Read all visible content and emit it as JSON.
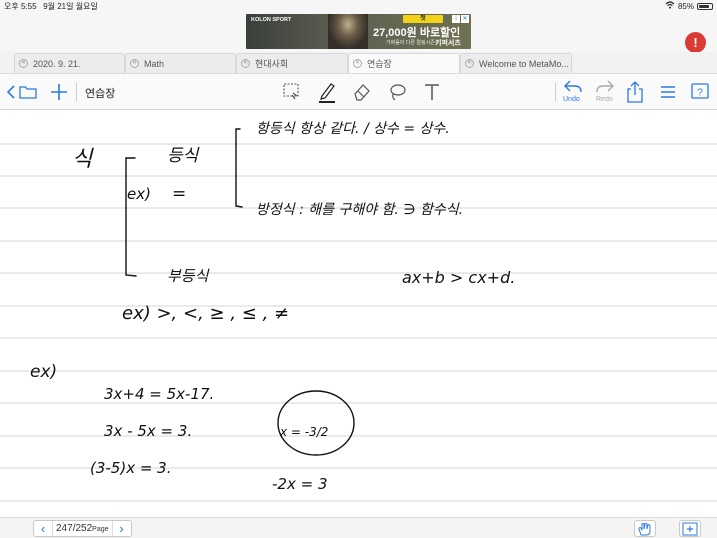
{
  "status_bar": {
    "time": "오후 5:55",
    "date": "9월 21일 월요일",
    "battery": "85%",
    "battery_level": 0.85
  },
  "ad": {
    "brand": "KOLON SPORT",
    "badge": "첫",
    "headline": "27,000원 바로할인",
    "sub": "가벼움이 다른 컬링시즌",
    "brand2": "키퍼서츠"
  },
  "record_button": {
    "glyph": "!"
  },
  "tabs": [
    {
      "label": "2020. 9. 21."
    },
    {
      "label": "Math"
    },
    {
      "label": "현대사회"
    },
    {
      "label": "연습장",
      "active": true
    },
    {
      "label": "Welcome to MetaMo..."
    }
  ],
  "toolbar": {
    "title": "연습장",
    "undo_label": "Undo",
    "redo_label": "Redo",
    "accent": "#2a7ae2"
  },
  "bottom_bar": {
    "page_current": "247",
    "page_total": "252",
    "page_suffix": "Page"
  },
  "handwriting": {
    "line1": "식",
    "equation": "등식",
    "equals_sign": "=",
    "ex1": "ex)",
    "identity": "항등식  항상 같다. / 상수 = 상수.",
    "conditional": "방정식 : 해를 구해야 함. ∋ 함수식.",
    "inequality": "부등식",
    "inequality_example": "ax+b > cx+d.",
    "ex2": "ex)  >, <, ≥ , ≤ , ≠",
    "ex3": "ex)",
    "step1": "3x+4 = 5x-17.",
    "step2": "3x - 5x = 3.",
    "step3": "(3-5)x = 3.",
    "answer": "x = -3/2",
    "side": "-2x = 3"
  }
}
